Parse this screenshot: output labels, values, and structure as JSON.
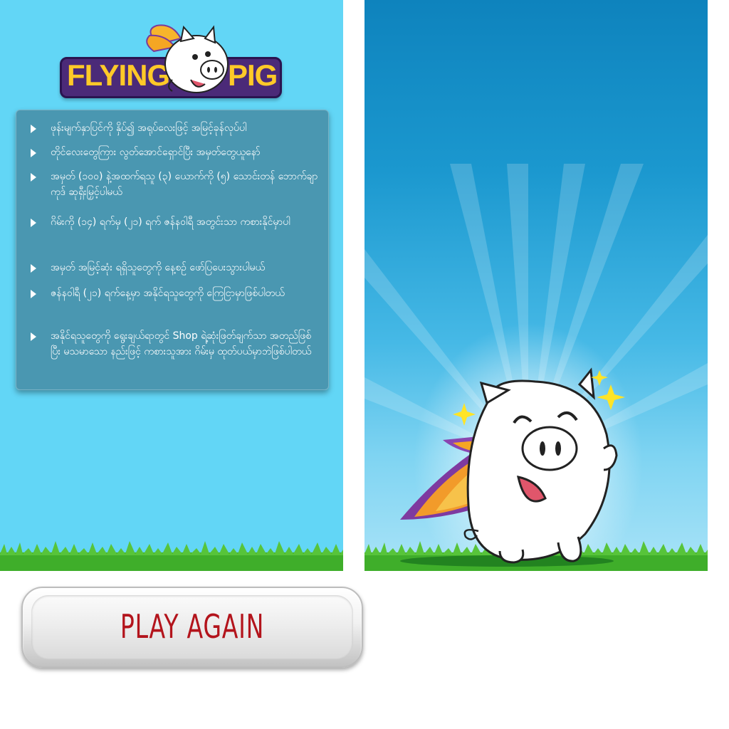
{
  "logo": {
    "word1": "FLYING",
    "word2": "PIG"
  },
  "rules": [
    "ဖုန်းမျက်နှာပြင်ကို နှိပ်၍ အရုပ်လေးဖြင့် အမြင့်ခုန်လုပ်ပါ",
    "တိုင်လေးတွေကြား လွတ်အောင်ရှောင်ပြီး အမှတ်တွေယူနော်",
    "အမှတ် (၁၀၀) နဲ့အထက်ရသူ (၃) ယောက်ကို (၅) သောင်းတန် ဘောက်ချာကုဒ် ဆုရှီးမြှင့်ပါမယ်",
    "ဂိမ်းကို (၁၄) ရက်မှ (၂၁) ရက် ဇန်နဝါရီ အတွင်းသာ ကစားနိုင်မှာပါ",
    "အမှတ် အမြင့်ဆုံး ရရှိသူတွေကို နေ့စဉ် ဖော်ပြပေးသွားပါမယ်",
    "ဇန်နဝါရီ (၂၁) ရက်နေ့မှာ အနိုင်ရသူတွေကို ကြေငြာမှာဖြစ်ပါတယ်",
    "အနိုင်ရသူတွေကို ရွေးချယ်ရာတွင် Shop ရဲ့ဆုံးဖြတ်ချက်သာ အတည်ဖြစ်ပြီး မသမာသော နည်းဖြင့် ကစားသူအား ဂိမ်းမှ ထုတ်ပယ်မှာဘဲဖြစ်ပါတယ်"
  ],
  "play_again_label": "PLAY AGAIN",
  "colors": {
    "sky_left": "#62d6f6",
    "sky_right_top": "#0e83bd",
    "grass": "#3fae2a",
    "play_again_text": "#b3141c",
    "logo_text": "#ffc928",
    "logo_plate": "#4b2a78"
  },
  "icons": [
    "bullet-arrow-icon",
    "sparkle-icon",
    "pig-mascot",
    "wing"
  ]
}
